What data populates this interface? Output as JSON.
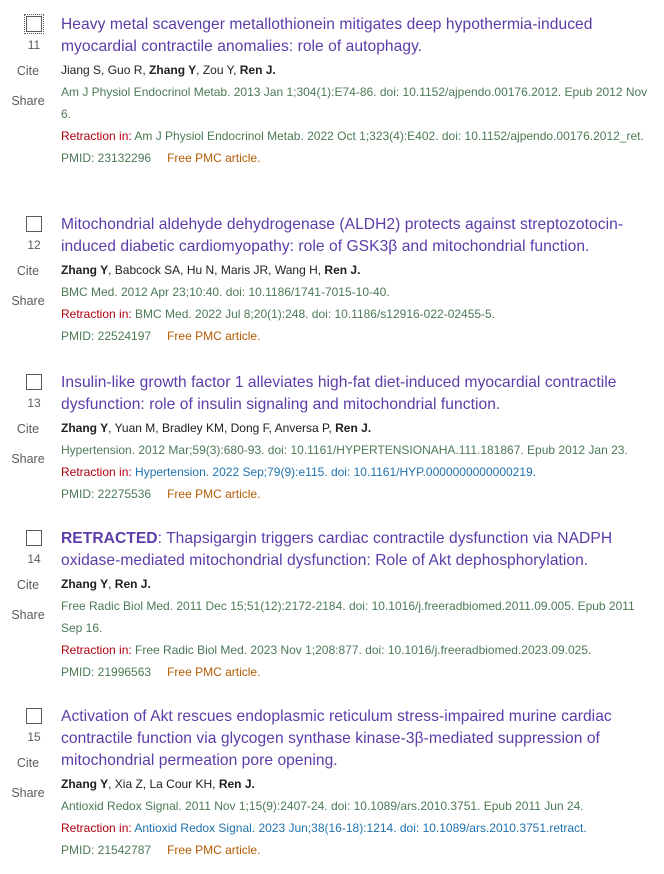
{
  "results": [
    {
      "number": "11",
      "cite_label": "Cite",
      "share_label": "Share",
      "retracted_prefix": "",
      "title": "Heavy metal scavenger metallothionein mitigates deep hypothermia-induced myocardial contractile anomalies: role of autophagy.",
      "authors_plain_1": "Jiang S, Guo R, ",
      "authors_bold_1": "Zhang Y",
      "authors_plain_2": ", Zou Y, ",
      "authors_bold_2": "Ren J.",
      "authors_plain_3": "",
      "citation": "Am J Physiol Endocrinol Metab. 2013 Jan 1;304(1):E74-86. doi: 10.1152/ajpendo.00176.2012. Epub 2012 Nov 6.",
      "retraction_label": "Retraction in:",
      "retraction_text": "Am J Physiol Endocrinol Metab. 2022 Oct 1;323(4):E402. doi: 10.1152/ajpendo.00176.2012_ret.",
      "pmid": "PMID: 23132296",
      "free_pmc": "Free PMC article."
    },
    {
      "number": "12",
      "cite_label": "Cite",
      "share_label": "Share",
      "retracted_prefix": "",
      "title": "Mitochondrial aldehyde dehydrogenase (ALDH2) protects against streptozotocin-induced diabetic cardiomyopathy: role of GSK3β and mitochondrial function.",
      "authors_plain_1": "",
      "authors_bold_1": "Zhang Y",
      "authors_plain_2": ", Babcock SA, Hu N, Maris JR, Wang H, ",
      "authors_bold_2": "Ren J.",
      "authors_plain_3": "",
      "citation": "BMC Med. 2012 Apr 23;10:40. doi: 10.1186/1741-7015-10-40.",
      "retraction_label": "Retraction in:",
      "retraction_text": "BMC Med. 2022 Jul 8;20(1):248. doi: 10.1186/s12916-022-02455-5.",
      "pmid": "PMID: 22524197",
      "free_pmc": "Free PMC article."
    },
    {
      "number": "13",
      "cite_label": "Cite",
      "share_label": "Share",
      "retracted_prefix": "",
      "title": "Insulin-like growth factor 1 alleviates high-fat diet-induced myocardial contractile dysfunction: role of insulin signaling and mitochondrial function.",
      "authors_plain_1": "",
      "authors_bold_1": "Zhang Y",
      "authors_plain_2": ", Yuan M, Bradley KM, Dong F, Anversa P, ",
      "authors_bold_2": "Ren J.",
      "authors_plain_3": "",
      "citation": "Hypertension. 2012 Mar;59(3):680-93. doi: 10.1161/HYPERTENSIONAHA.111.181867. Epub 2012 Jan 23.",
      "retraction_label": "Retraction in:",
      "retraction_text": "Hypertension. 2022 Sep;79(9):e115. doi: 10.1161/HYP.0000000000000219.",
      "pmid": "PMID: 22275536",
      "free_pmc": "Free PMC article."
    },
    {
      "number": "14",
      "cite_label": "Cite",
      "share_label": "Share",
      "retracted_prefix": "RETRACTED",
      "title": ": Thapsigargin triggers cardiac contractile dysfunction via NADPH oxidase-mediated mitochondrial dysfunction: Role of Akt dephosphorylation.",
      "authors_plain_1": "",
      "authors_bold_1": "Zhang Y",
      "authors_plain_2": ", ",
      "authors_bold_2": "Ren J.",
      "authors_plain_3": "",
      "citation": "Free Radic Biol Med. 2011 Dec 15;51(12):2172-2184. doi: 10.1016/j.freeradbiomed.2011.09.005. Epub 2011 Sep 16.",
      "retraction_label": "Retraction in:",
      "retraction_text": "Free Radic Biol Med. 2023 Nov 1;208:877. doi: 10.1016/j.freeradbiomed.2023.09.025.",
      "pmid": "PMID: 21996563",
      "free_pmc": "Free PMC article."
    },
    {
      "number": "15",
      "cite_label": "Cite",
      "share_label": "Share",
      "retracted_prefix": "",
      "title": "Activation of Akt rescues endoplasmic reticulum stress-impaired murine cardiac contractile function via glycogen synthase kinase-3β-mediated suppression of mitochondrial permeation pore opening.",
      "authors_plain_1": "",
      "authors_bold_1": "Zhang Y",
      "authors_plain_2": ", Xia Z, La Cour KH, ",
      "authors_bold_2": "Ren J.",
      "authors_plain_3": "",
      "citation": "Antioxid Redox Signal. 2011 Nov 1;15(9):2407-24. doi: 10.1089/ars.2010.3751. Epub 2011 Jun 24.",
      "retraction_label": "Retraction in:",
      "retraction_text": "Antioxid Redox Signal. 2023 Jun;38(16-18):1214. doi: 10.1089/ars.2010.3751.retract.",
      "pmid": "PMID: 21542787",
      "free_pmc": "Free PMC article."
    }
  ],
  "colors": {
    "title": "#5b3ca8",
    "citation": "#4c7a56",
    "retraction_label": "#b0000e",
    "retraction_link_blue": "#1f72b0",
    "free_pmc": "#b55a00",
    "side_text": "#5b5b5b"
  }
}
